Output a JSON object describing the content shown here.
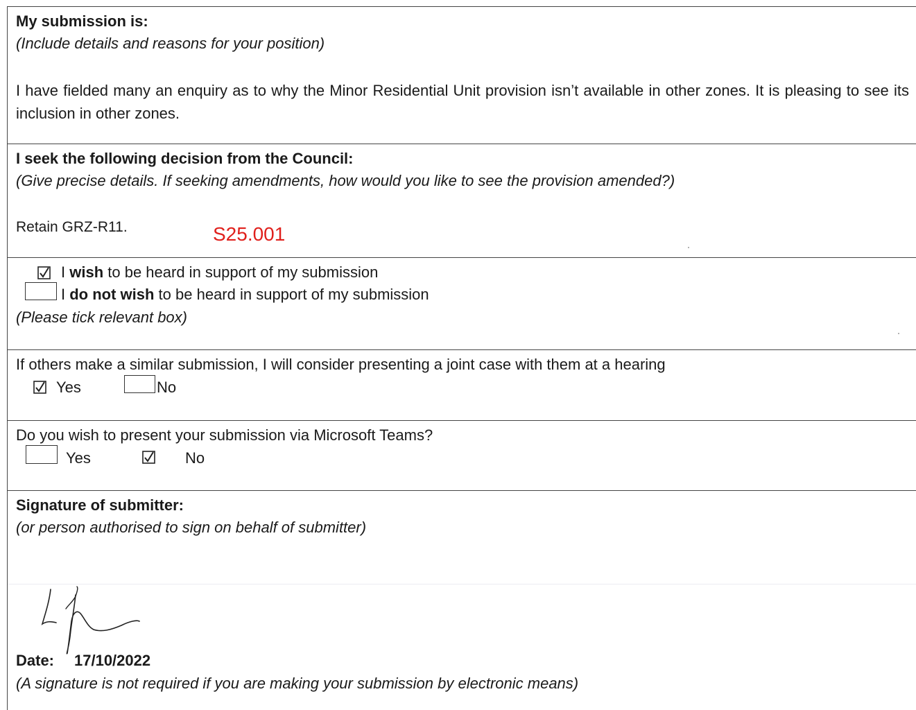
{
  "submission": {
    "heading": "My submission is:",
    "instruction": "(Include details and reasons for your position)",
    "body": "I have fielded many an enquiry as to why the Minor Residential Unit provision isn’t available in other zones. It is pleasing to see its inclusion in other zones."
  },
  "decision": {
    "heading": "I seek the following decision from the Council:",
    "instruction": "(Give precise details. If seeking amendments, how would you like to see the provision amended?)",
    "body": "Retain GRZ-R11.",
    "reference": "S25.001",
    "reference_color": "#e0201c"
  },
  "hearing": {
    "wish_prefix": "I ",
    "wish_bold": "wish",
    "wish_suffix": " to be heard in support of my submission",
    "wish_checked": true,
    "not_wish_prefix": "I ",
    "not_wish_bold": "do not wish",
    "not_wish_suffix": " to be heard in support of my submission",
    "not_wish_checked": false,
    "instruction": "(Please tick relevant box)"
  },
  "joint_case": {
    "question": "If others make a similar submission, I will consider presenting a joint case with them at a hearing",
    "yes_label": "Yes",
    "yes_checked": true,
    "no_label": "No",
    "no_checked": false
  },
  "teams": {
    "question": "Do you wish to present your submission via Microsoft Teams?",
    "yes_label": "Yes",
    "yes_checked": false,
    "no_label": "No",
    "no_checked": true
  },
  "signature": {
    "heading": "Signature of submitter:",
    "instruction": "(or person authorised to sign on behalf of submitter)",
    "date_label": "Date:",
    "date_value": "17/10/2022",
    "note": "(A signature is not required if you are making your submission by electronic means)"
  },
  "icons": {
    "checked_box": "checkbox-checked-icon",
    "empty_box": "checkbox-empty-icon",
    "signature": "handwritten-signature"
  }
}
